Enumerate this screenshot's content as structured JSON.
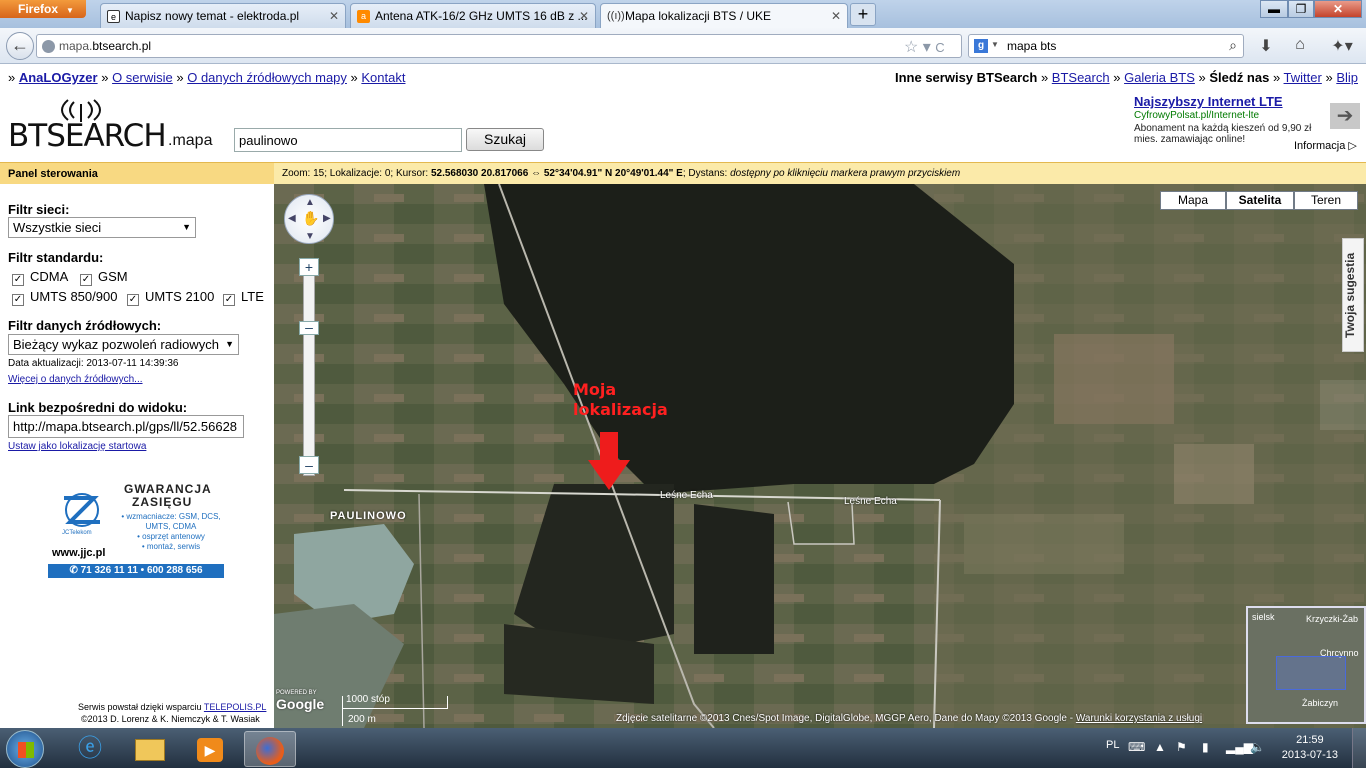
{
  "browser": {
    "app_button": "Firefox",
    "tabs": [
      {
        "title": "Napisz nowy temat - elektroda.pl",
        "favicon": "elektroda-icon"
      },
      {
        "title": "Antena ATK-16/2 GHz UMTS 16 dB z ...",
        "favicon": "allegro-icon"
      },
      {
        "title": "Mapa lokalizacji BTS / UKE",
        "favicon": "bts-antenna-icon",
        "active": true
      }
    ],
    "url_prefix": "mapa.",
    "url_domain": "btsearch.pl",
    "search_value": "mapa bts"
  },
  "site_nav": {
    "links": [
      "AnaLOGyzer",
      "O serwisie",
      "O danych źródłowych mapy",
      "Kontakt"
    ],
    "right_label": "Inne serwisy BTSearch",
    "right_links": [
      "BTSearch",
      "Galeria BTS"
    ],
    "follow_label": "Śledź nas",
    "follow_links": [
      "Twitter",
      "Blip"
    ]
  },
  "logo": {
    "text": "BTSEARCH",
    "suffix": ".mapa"
  },
  "search": {
    "value": "paulinowo",
    "button": "Szukaj"
  },
  "ad": {
    "title": "Najszybszy Internet LTE",
    "url": "CyfrowyPolsat.pl/Internet-lte",
    "desc": "Abonament na każdą kieszeń od 9,90 zł mies. zamawiając online!",
    "info": "Informacja"
  },
  "panel": {
    "header": "Panel sterowania",
    "network_filter_label": "Filtr sieci:",
    "network_filter_value": "Wszystkie sieci",
    "standard_filter_label": "Filtr standardu:",
    "standards": [
      "CDMA",
      "GSM",
      "UMTS 850/900",
      "UMTS 2100",
      "LTE"
    ],
    "source_filter_label": "Filtr danych źródłowych:",
    "source_filter_value": "Bieżący wykaz pozwoleń radiowych",
    "update_date": "Data aktualizacji: 2013-07-11 14:39:36",
    "more_link": "Więcej o danych źródłowych...",
    "direct_link_label": "Link bezpośredni do widoku:",
    "direct_link_value": "http://mapa.btsearch.pl/gps/ll/52.56628",
    "set_start_link": "Ustaw jako lokalizację startowa",
    "promo": {
      "title_1": "GWARANCJA",
      "title_2": "ZASIĘGU",
      "brand": "JCTelekom",
      "items": [
        "• wzmacniacze: GSM, DCS,",
        "UMTS, CDMA",
        "• osprzęt antenowy",
        "• montaż, serwis"
      ],
      "site": "www.jjc.pl",
      "phones": "✆ 71 326 11 11 • 600 288 656"
    },
    "footer_1": "Serwis powstał dzięki wsparciu",
    "footer_link": "TELEPOLIS.PL",
    "footer_2": "©2013 D. Lorenz & K. Niemczyk & T. Wasiak"
  },
  "status_bar": {
    "text": "Zoom: 15; Lokalizacje: 0; Kursor: ",
    "coords": "52.568030 20.817066 ⇔ 52°34'04.91\" N 20°49'01.44\" E",
    "distance": "; Dystans: ",
    "distance_value": "dostępny po kliknięciu markera prawym przyciskiem"
  },
  "map": {
    "type_buttons": [
      "Mapa",
      "Satelita",
      "Teren"
    ],
    "active_type": "Satelita",
    "marker_label_1": "Moja",
    "marker_label_2": "lokalizacja",
    "place_labels": [
      "PAULINOWO",
      "Leśne Echa",
      "Leśne Echa"
    ],
    "mini_labels": [
      "sielsk",
      "Krzyczki-Żab",
      "Chrcynno",
      "Żabiczyn"
    ],
    "suggestion": "Twoja sugestia",
    "scale_top": "1000 stóp",
    "scale_bottom": "200 m",
    "google_logo": "Google",
    "powered_by": "POWERED BY",
    "copyright": "Zdjęcie satelitarne ©2013 Cnes/Spot Image, DigitalGlobe, MGGP Aero, Dane do Mapy ©2013 Google - ",
    "terms_link": "Warunki korzystania z usługi"
  },
  "taskbar": {
    "lang": "PL",
    "time": "21:59",
    "date": "2013-07-13"
  }
}
